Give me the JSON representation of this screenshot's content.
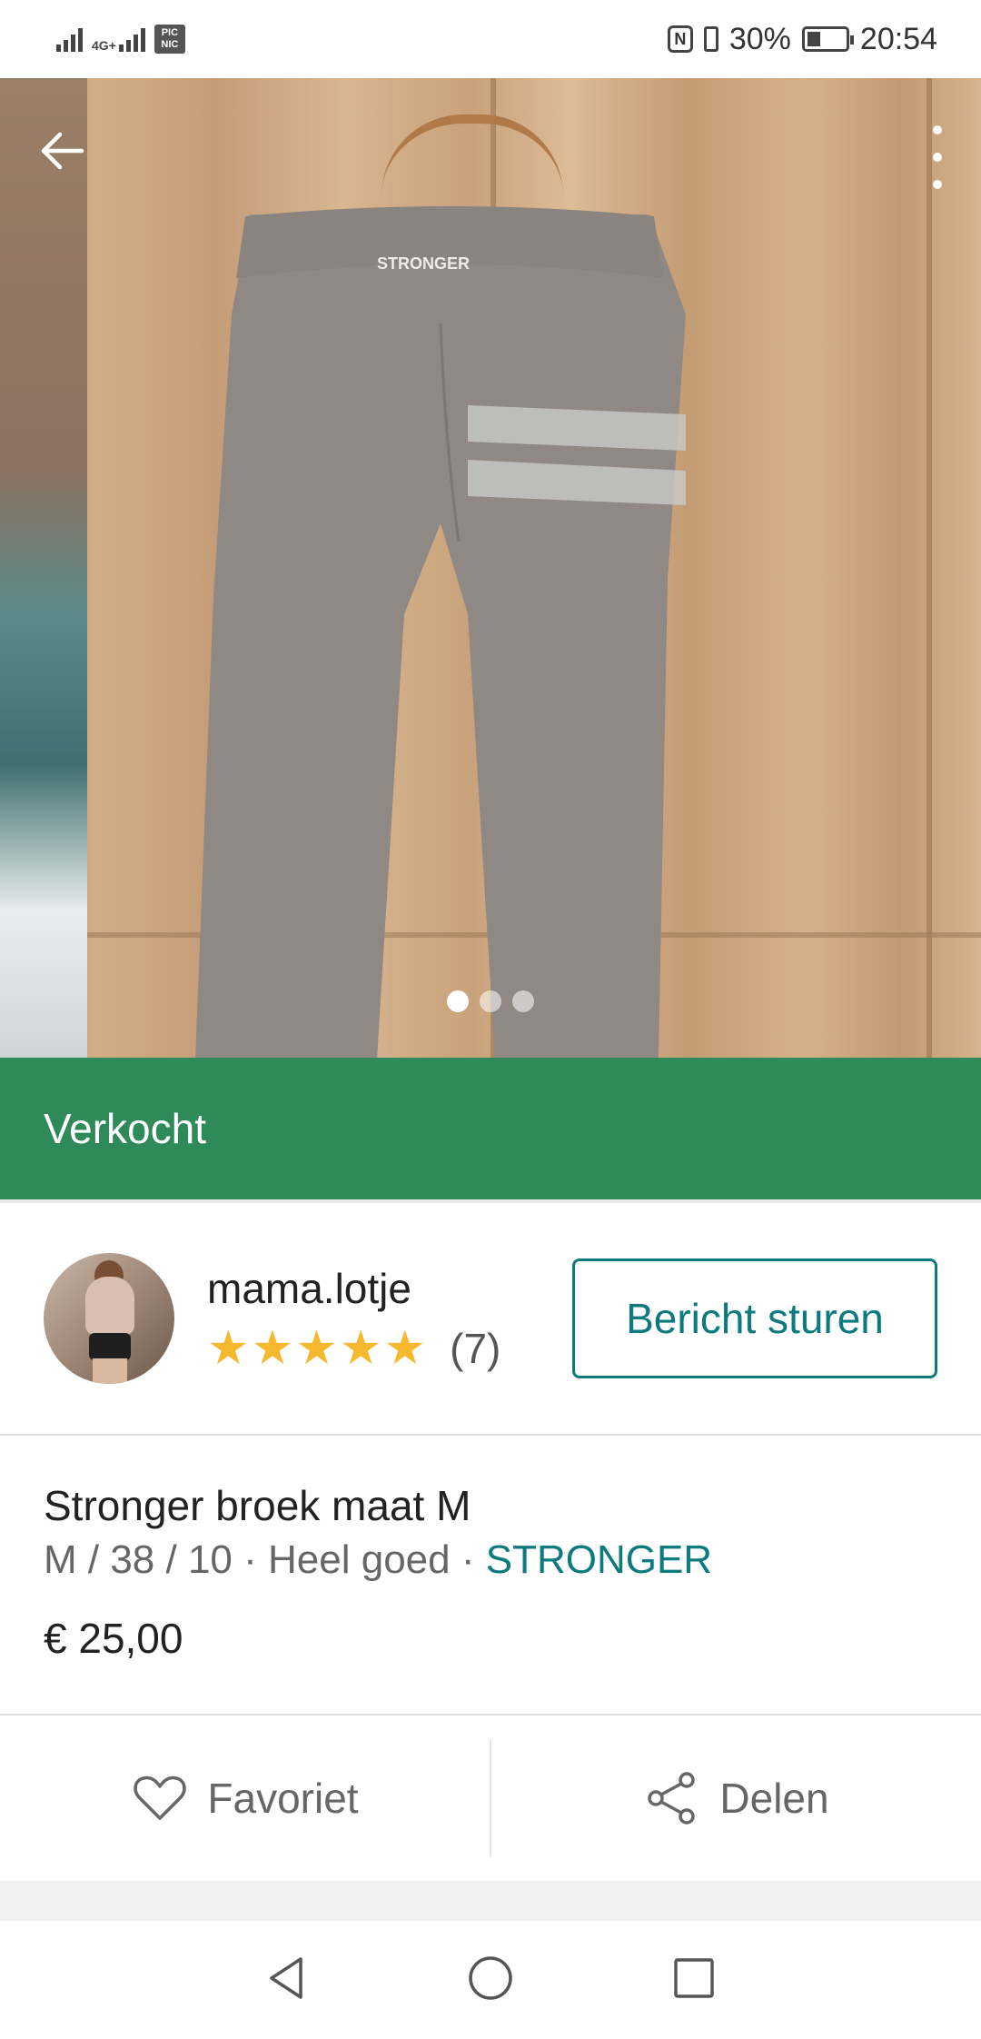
{
  "status_bar": {
    "network_label": "4G+",
    "picnic_label": "PIC NIC",
    "battery_percent": "30%",
    "battery_level": 0.3,
    "time": "20:54",
    "icons": [
      "signal-icon",
      "signal-4g-icon",
      "picnic-app-icon",
      "nfc-icon",
      "vibrate-icon",
      "battery-icon"
    ]
  },
  "header": {
    "back_icon": "arrow-left-icon",
    "more_icon": "more-vertical-icon"
  },
  "gallery": {
    "image_count": 3,
    "active_index": 0,
    "waistband_text": "STRONGER"
  },
  "banner": {
    "label": "Verkocht",
    "color": "#2f8a5a"
  },
  "seller": {
    "name": "mama.lotje",
    "stars": 5,
    "rating_count": "(7)",
    "message_button": "Bericht sturen"
  },
  "item": {
    "title": "Stronger broek maat M",
    "size": "M / 38 / 10",
    "separator": " · ",
    "condition": "Heel goed",
    "brand": "STRONGER",
    "price": "€ 25,00"
  },
  "actions": {
    "favorite_label": "Favoriet",
    "share_label": "Delen"
  },
  "colors": {
    "accent": "#0c7a7e",
    "star": "#f5b82e"
  }
}
